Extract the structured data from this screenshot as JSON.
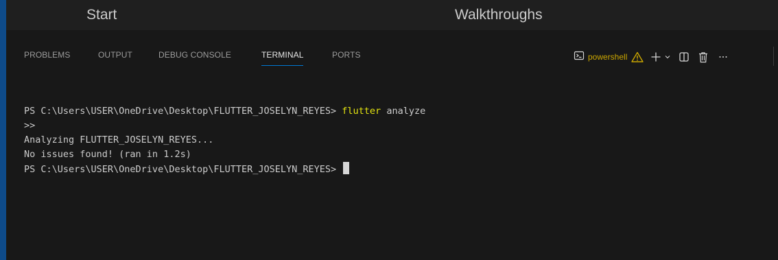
{
  "editor_tabs": {
    "start": "Start",
    "walkthroughs": "Walkthroughs"
  },
  "panel": {
    "tabs": [
      "PROBLEMS",
      "OUTPUT",
      "DEBUG CONSOLE",
      "TERMINAL",
      "PORTS"
    ],
    "active_tab": "TERMINAL",
    "toolbar": {
      "shell_label": "powershell",
      "icons": [
        "terminal-icon",
        "warning-icon",
        "plus-icon",
        "chevron-down-icon",
        "split-icon",
        "trash-icon",
        "more-icon"
      ]
    }
  },
  "terminal": {
    "prompt": "PS C:\\Users\\USER\\OneDrive\\Desktop\\FLUTTER_JOSELYN_REYES> ",
    "command_keyword": "flutter",
    "command_args": " analyze",
    "continuation": ">>",
    "output_1": "Analyzing FLUTTER_JOSELYN_REYES...",
    "output_2": "No issues found! (ran in 1.2s)",
    "final_prompt": "PS C:\\Users\\USER\\OneDrive\\Desktop\\FLUTTER_JOSELYN_REYES> "
  },
  "colors": {
    "accent": "#0078d4",
    "command": "#e5e510",
    "warning": "#cca700",
    "background": "#181818"
  }
}
